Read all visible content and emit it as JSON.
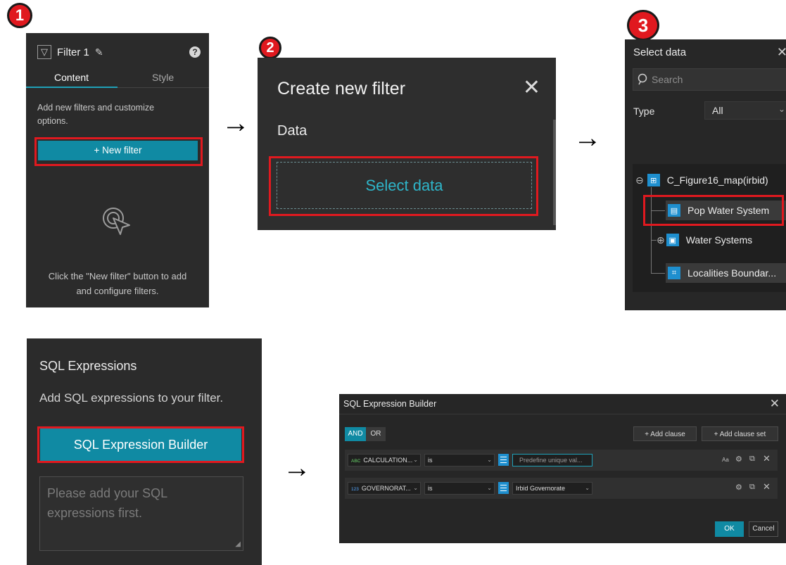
{
  "steps": {
    "one": "1",
    "two": "2",
    "three": "3"
  },
  "arrow_glyph": "→",
  "panel1": {
    "title": "Filter 1",
    "tabs": [
      "Content",
      "Style"
    ],
    "hint": "Add new filters and customize options.",
    "new_filter_button": "+ New filter",
    "bottom_text": "Click the \"New filter\" button to add and configure filters."
  },
  "panel2": {
    "title": "Create new filter",
    "section": "Data",
    "select_data": "Select data",
    "close_glyph": "✕"
  },
  "panel3": {
    "title": "Select data",
    "search_placeholder": "Search",
    "type_label": "Type",
    "type_value": "All",
    "tree": {
      "root": "C_Figure16_map(irbid)",
      "items": [
        "Pop Water System",
        "Water Systems",
        "Localities Boundar..."
      ]
    }
  },
  "panel4": {
    "title": "SQL Expressions",
    "subtitle": "Add SQL expressions to your filter.",
    "builder_button": "SQL Expression Builder",
    "textarea_placeholder": "Please add your SQL expressions first."
  },
  "panel5": {
    "title": "SQL Expression Builder",
    "logic": [
      "AND",
      "OR"
    ],
    "add_clause": "+ Add clause",
    "add_clause_set": "+ Add clause set",
    "clauses": [
      {
        "type_tag": "ABC",
        "field": "CALCULATION...",
        "operator": "is",
        "value": "Predefine unique val..."
      },
      {
        "type_tag": "123",
        "field": "GOVERNORAT...",
        "operator": "is",
        "value": "Irbid Governorate"
      }
    ],
    "ok": "OK",
    "cancel": "Cancel"
  },
  "colors": {
    "accent": "#108aa3",
    "highlight": "#e0191f",
    "panel_bg": "#2b2b2b"
  }
}
